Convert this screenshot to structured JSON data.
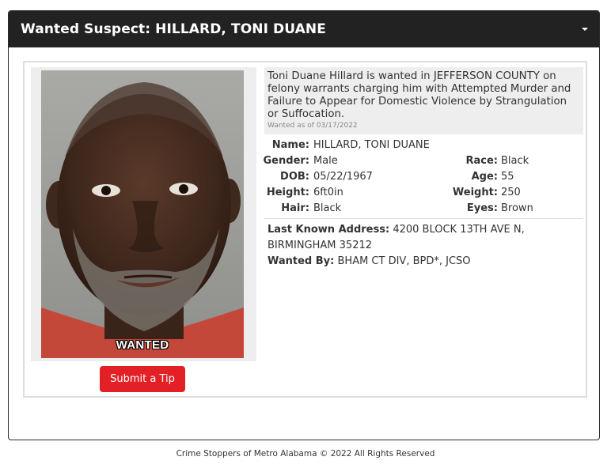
{
  "panel": {
    "title": "Wanted Suspect: HILLARD, TONI DUANE",
    "collapse_icon": "caret-down-icon"
  },
  "photo": {
    "stamp": "WANTED"
  },
  "tip_button": "Submit a Tip",
  "summary": {
    "text": "Toni Duane Hillard is wanted in JEFFERSON COUNTY on felony warrants charging him with Attempted Murder and Failure to Appear for Domestic Violence by Strangulation or Suffocation.",
    "as_of": "Wanted as of 03/17/2022"
  },
  "details": {
    "name": {
      "label": "Name:",
      "value": "HILLARD, TONI DUANE"
    },
    "gender": {
      "label": "Gender:",
      "value": "Male"
    },
    "race": {
      "label": "Race:",
      "value": "Black"
    },
    "dob": {
      "label": "DOB:",
      "value": "05/22/1967"
    },
    "age": {
      "label": "Age:",
      "value": "55"
    },
    "height": {
      "label": "Height:",
      "value": "6ft0in"
    },
    "weight": {
      "label": "Weight:",
      "value": "250"
    },
    "hair": {
      "label": "Hair:",
      "value": "Black"
    },
    "eyes": {
      "label": "Eyes:",
      "value": "Brown"
    }
  },
  "address": {
    "label": "Last Known Address:",
    "value": "4200 BLOCK 13TH AVE N, BIRMINGHAM 35212"
  },
  "wanted_by": {
    "label": "Wanted By:",
    "value": "BHAM CT DIV, BPD*, JCSO"
  },
  "footer": "Crime Stoppers of Metro Alabama © 2022 All Rights Reserved",
  "colors": {
    "heading_bg": "#222222",
    "tip_button_bg": "#e32026"
  }
}
